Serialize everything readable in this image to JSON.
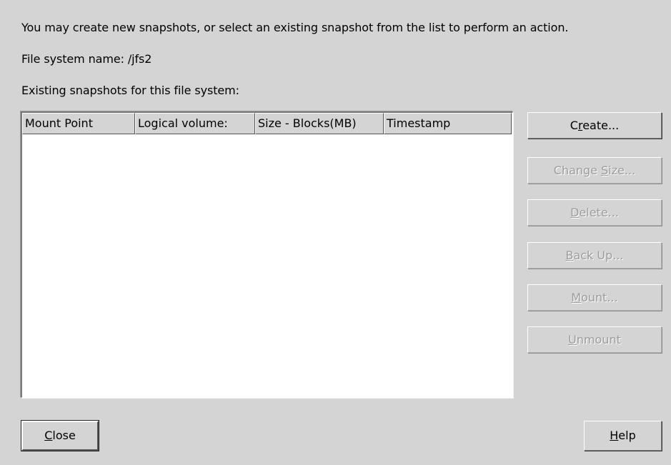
{
  "intro_text": "You may create new snapshots, or select an existing snapshot from the list to perform an action.",
  "fs_name_label": "File system name: /jfs2",
  "existing_label": "Existing snapshots for this file system:",
  "table": {
    "columns": [
      "Mount Point",
      "Logical volume:",
      "Size - Blocks(MB)",
      "Timestamp"
    ],
    "rows": []
  },
  "buttons": {
    "create": {
      "pre": "C",
      "u": "r",
      "post": "eate..."
    },
    "change_size": {
      "pre": "Change ",
      "u": "S",
      "post": "ize..."
    },
    "delete": {
      "pre": "",
      "u": "D",
      "post": "elete..."
    },
    "back_up": {
      "pre": "",
      "u": "B",
      "post": "ack Up..."
    },
    "mount": {
      "pre": "",
      "u": "M",
      "post": "ount..."
    },
    "unmount": {
      "pre": "",
      "u": "U",
      "post": "nmount"
    },
    "close": {
      "pre": "",
      "u": "C",
      "post": "lose"
    },
    "help": {
      "pre": "",
      "u": "H",
      "post": "elp"
    }
  },
  "colors": {
    "background": "#d4d4d4",
    "disabled_text": "#9c9c9c",
    "table_background": "#ffffff"
  }
}
